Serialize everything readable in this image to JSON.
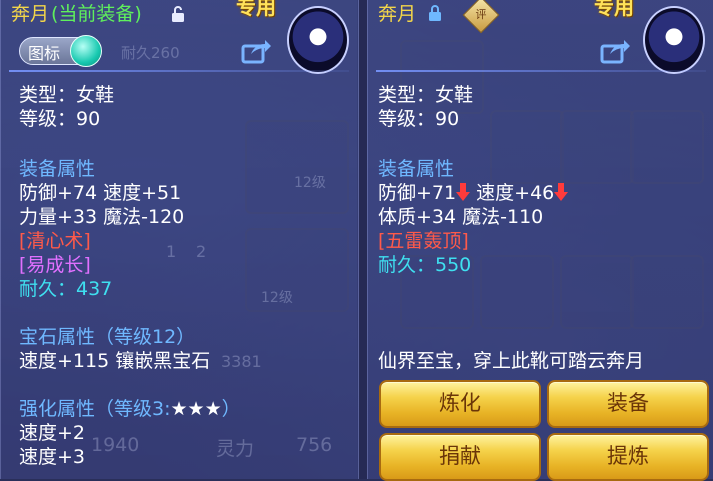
{
  "left": {
    "item_name": "奔月",
    "equipped_label": "(当前装备)",
    "exclusive": "专用",
    "toggle_label": "图标",
    "faint_durability": "耐久260",
    "type": "类型：女鞋",
    "level": "等级：90",
    "attr_header": "装备属性",
    "attr_line1": "防御+74 速度+51",
    "attr_line2": "力量+33 魔法-120",
    "skill1": "[清心术]",
    "skill2": "[易成长]",
    "durability": "耐久：437",
    "gem_header": "宝石属性（等级12）",
    "gem_line": "速度+115 镶嵌黑宝石",
    "enhance_header": "强化属性（等级3:",
    "enhance_stars": "★★★",
    "enhance_close": "）",
    "enhance_line1": "速度+2",
    "enhance_line2": "速度+3",
    "bg_level_badge1": "12级",
    "bg_level_badge2": "12级",
    "bg_tab1": "1",
    "bg_tab2": "2",
    "bg_number1": "3381",
    "bg_number2": "1940",
    "bg_label": "灵力",
    "bg_number3": "756"
  },
  "right": {
    "item_name": "奔月",
    "badge": "评",
    "exclusive": "专用",
    "type": "类型：女鞋",
    "level": "等级：90",
    "attr_header": "装备属性",
    "attr_line1_a": "防御+71",
    "attr_line1_b": "速度+46",
    "attr_line2": "体质+34 魔法-110",
    "skill1": "[五雷轰顶]",
    "durability": "耐久：550",
    "description": "仙界至宝，穿上此靴可踏云奔月",
    "buttons": {
      "refine": "炼化",
      "equip": "装备",
      "donate": "捐献",
      "extract": "提炼"
    }
  },
  "colors": {
    "title_yellow": "#f2d54a",
    "equipped_green": "#5ff05c",
    "header_blue": "#6fb8ff",
    "durability_cyan": "#3fe0f0",
    "skill_red": "#ff5a4a",
    "skill_purple": "#e070ff",
    "button_gold": "#f5d24a"
  }
}
